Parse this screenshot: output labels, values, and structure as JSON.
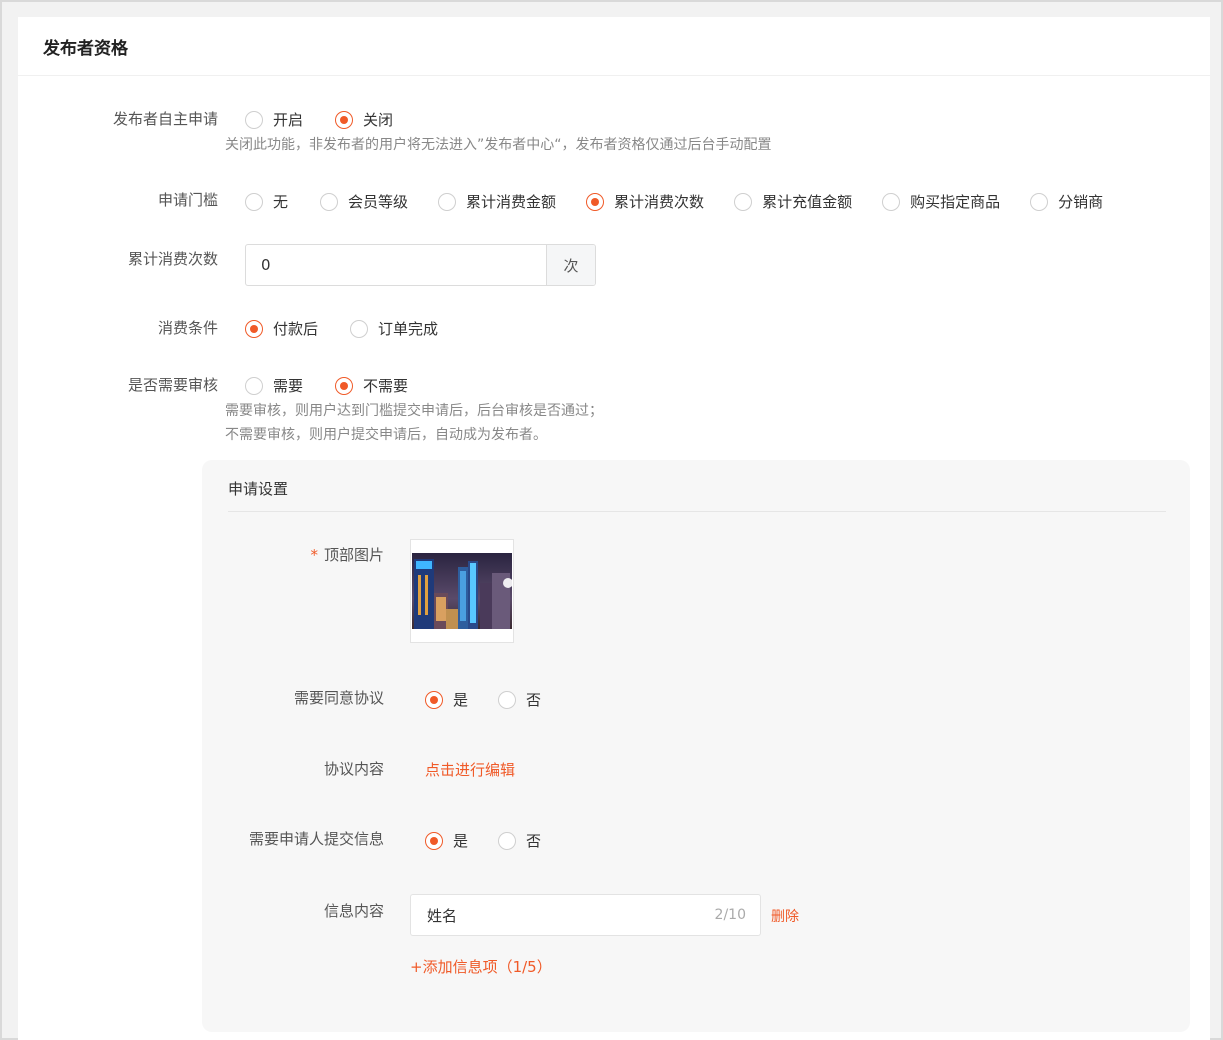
{
  "header": {
    "title": "发布者资格"
  },
  "self_apply": {
    "label": "发布者自主申请",
    "options": [
      "开启",
      "关闭"
    ],
    "hint": "关闭此功能，非发布者的用户将无法进入”发布者中心“，发布者资格仅通过后台手动配置"
  },
  "threshold": {
    "label": "申请门槛",
    "options": [
      "无",
      "会员等级",
      "累计消费金额",
      "累计消费次数",
      "累计充值金额",
      "购买指定商品",
      "分销商"
    ]
  },
  "count": {
    "label": "累计消费次数",
    "value": "0",
    "unit": "次"
  },
  "condition": {
    "label": "消费条件",
    "options": [
      "付款后",
      "订单完成"
    ]
  },
  "review": {
    "label": "是否需要审核",
    "options": [
      "需要",
      "不需要"
    ],
    "hint1": "需要审核，则用户达到门槛提交申请后，后台审核是否通过；",
    "hint2": "不需要审核，则用户提交申请后，自动成为发布者。"
  },
  "apply_settings": {
    "title": "申请设置",
    "top_image": {
      "required_mark": "*",
      "label": "顶部图片"
    },
    "agreement": {
      "label": "需要同意协议",
      "options": [
        "是",
        "否"
      ]
    },
    "agreement_content": {
      "label": "协议内容",
      "link": "点击进行编辑"
    },
    "submit_info": {
      "label": "需要申请人提交信息",
      "options": [
        "是",
        "否"
      ]
    },
    "info_content": {
      "label": "信息内容",
      "value": "姓名",
      "counter": "2/10",
      "delete": "删除",
      "add": "+添加信息项（1/5）"
    }
  },
  "colors": {
    "accent": "#f05a28"
  }
}
